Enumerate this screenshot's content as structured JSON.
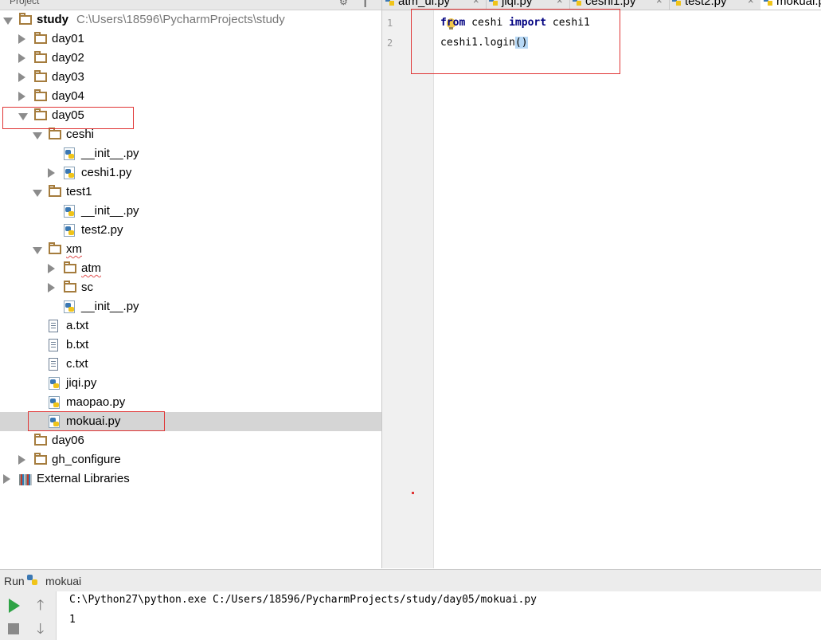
{
  "project_panel": {
    "header_label": "Project",
    "header_buttons": [
      "⚙",
      "┃"
    ]
  },
  "tree": [
    {
      "label": "study",
      "path": "C:\\Users\\18596\\PycharmProjects\\study",
      "type": "folder",
      "depth": 0,
      "expanded": true,
      "bold": true
    },
    {
      "label": "day01",
      "type": "folder",
      "depth": 1,
      "expanded": false
    },
    {
      "label": "day02",
      "type": "folder",
      "depth": 1,
      "expanded": false
    },
    {
      "label": "day03",
      "type": "folder",
      "depth": 1,
      "expanded": false
    },
    {
      "label": "day04",
      "type": "folder",
      "depth": 1,
      "expanded": false
    },
    {
      "label": "day05",
      "type": "folder",
      "depth": 1,
      "expanded": true
    },
    {
      "label": "ceshi",
      "type": "folder",
      "depth": 2,
      "expanded": true
    },
    {
      "label": "__init__.py",
      "type": "py",
      "depth": 3
    },
    {
      "label": "ceshi1.py",
      "type": "py",
      "depth": 3,
      "expandable": true
    },
    {
      "label": "test1",
      "type": "folder",
      "depth": 2,
      "expanded": true
    },
    {
      "label": "__init__.py",
      "type": "py",
      "depth": 3
    },
    {
      "label": "test2.py",
      "type": "py",
      "depth": 3
    },
    {
      "label": "xm",
      "type": "folder",
      "depth": 2,
      "expanded": true,
      "squiggle": true
    },
    {
      "label": "atm",
      "type": "folder",
      "depth": 3,
      "expanded": false,
      "squiggle": true
    },
    {
      "label": "sc",
      "type": "folder",
      "depth": 3,
      "expanded": false
    },
    {
      "label": "__init__.py",
      "type": "py",
      "depth": 3
    },
    {
      "label": "a.txt",
      "type": "txt",
      "depth": 2
    },
    {
      "label": "b.txt",
      "type": "txt",
      "depth": 2
    },
    {
      "label": "c.txt",
      "type": "txt",
      "depth": 2
    },
    {
      "label": "jiqi.py",
      "type": "py",
      "depth": 2
    },
    {
      "label": "maopao.py",
      "type": "py",
      "depth": 2
    },
    {
      "label": "mokuai.py",
      "type": "py",
      "depth": 2,
      "selected": true
    },
    {
      "label": "day06",
      "type": "folder",
      "depth": 1
    },
    {
      "label": "gh_configure",
      "type": "folder",
      "depth": 1,
      "expanded": false
    },
    {
      "label": "External Libraries",
      "type": "libs",
      "depth": 0,
      "expanded": false
    }
  ],
  "tabs": [
    {
      "label": "atm_ui.py"
    },
    {
      "label": "jiqi.py"
    },
    {
      "label": "ceshi1.py"
    },
    {
      "label": "test2.py"
    },
    {
      "label": "mokuai.py",
      "active": true
    }
  ],
  "editor": {
    "line_numbers": [
      "1",
      "2"
    ],
    "line1": {
      "kw1": "from",
      "mod": " ceshi ",
      "kw2": "import",
      "name": " ceshi1"
    },
    "line2": {
      "pre": "ceshi1.login",
      "brace_open": "(",
      "brace_close": ")"
    }
  },
  "run": {
    "label": "Run",
    "config_name": "mokuai",
    "output": [
      "C:\\Python27\\python.exe C:/Users/18596/PycharmProjects/study/day05/mokuai.py",
      "1"
    ]
  },
  "colors": {
    "selection": "#d5d5d5",
    "keyword": "#000080",
    "highlight_box": "#e03535",
    "run_play": "#2ea345",
    "folder": "#a57c3d"
  }
}
